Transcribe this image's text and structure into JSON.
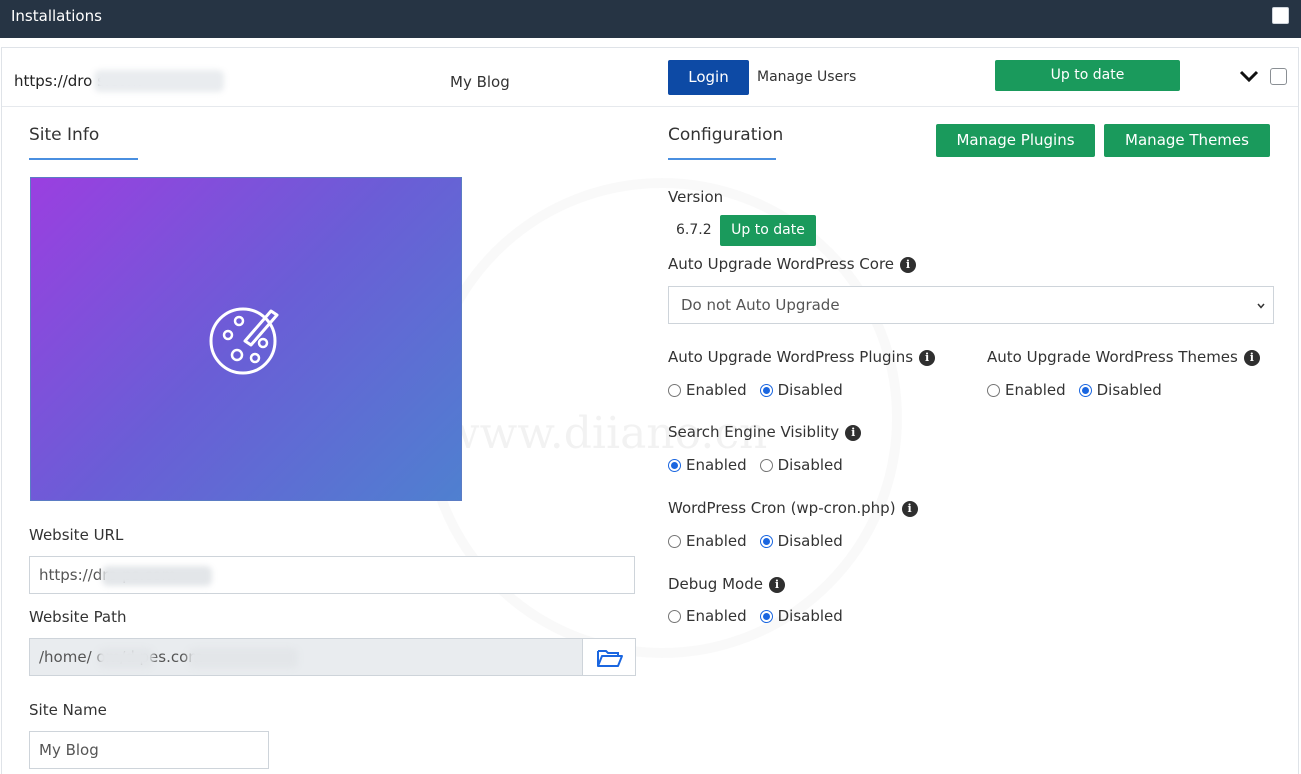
{
  "topbar": {
    "title": "Installations"
  },
  "installation": {
    "url": "https://dro                    s.com",
    "site_name": "My Blog",
    "login_label": "Login",
    "manage_users_label": "Manage Users",
    "status_label": "Up to date"
  },
  "site_info": {
    "title": "Site Info",
    "website_url_label": "Website URL",
    "website_url_value": "https://dro                ps.com",
    "website_path_label": "Website Path",
    "website_path_value": "/home/          om/d                    pes.com",
    "site_name_label": "Site Name",
    "site_name_value": "My Blog"
  },
  "configuration": {
    "title": "Configuration",
    "manage_plugins_label": "Manage Plugins",
    "manage_themes_label": "Manage Themes",
    "version_label": "Version",
    "version_value": "6.7.2",
    "version_status": "Up to date",
    "core_label": "Auto Upgrade WordPress Core",
    "core_value": "Do not Auto Upgrade",
    "plugins_label": "Auto Upgrade WordPress Plugins",
    "themes_label": "Auto Upgrade WordPress Themes",
    "seo_label": "Search Engine Visiblity",
    "cron_label": "WordPress Cron (wp-cron.php)",
    "debug_label": "Debug Mode",
    "enabled": "Enabled",
    "disabled": "Disabled",
    "info_glyph": "i"
  },
  "watermark": "www.diiano.cn",
  "colors": {
    "topbar": "#263444",
    "login": "#0d4aa5",
    "green": "#1a9a5c",
    "accent": "#4a8fe0"
  }
}
